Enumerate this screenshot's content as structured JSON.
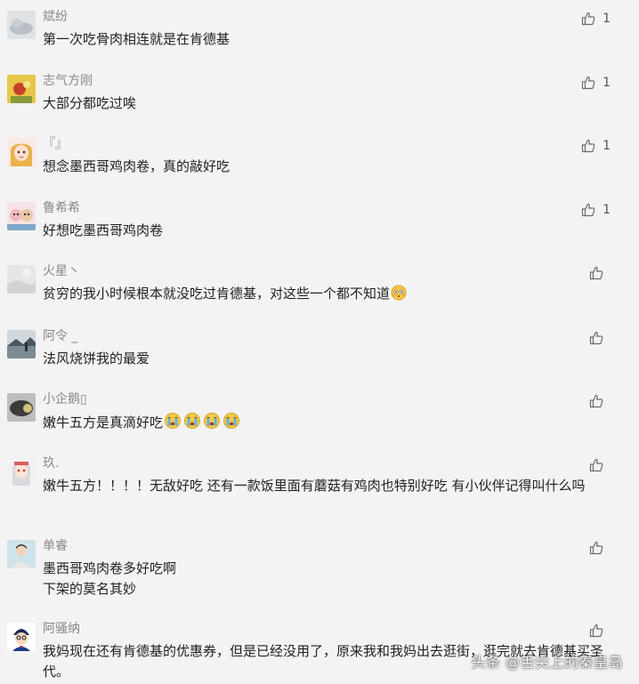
{
  "comments": [
    {
      "user": "斌纷",
      "text": "第一次吃骨肉相连就是在肯德基",
      "likes": "1",
      "avatar_icon": "gray-cloud-avatar-icon"
    },
    {
      "user": "志气方刚",
      "text": "大部分都吃过唉",
      "likes": "1",
      "avatar_icon": "yellow-flower-avatar-icon"
    },
    {
      "user": "『』",
      "text": "想念墨西哥鸡肉卷，真的敲好吃",
      "likes": "1",
      "avatar_icon": "cartoon-girl-avatar-icon"
    },
    {
      "user": "鲁希希",
      "text": "好想吃墨西哥鸡肉卷",
      "likes": "1",
      "avatar_icon": "pink-cartoon-avatar-icon"
    },
    {
      "user": "火星丶",
      "text": "贫穷的我小时候根本就没吃过肯德基，对这些一个都不知道",
      "likes": "",
      "avatar_icon": "gray-blur-avatar-icon"
    },
    {
      "user": "阿令 _",
      "text": "法风烧饼我的最爱",
      "likes": "",
      "avatar_icon": "landscape-avatar-icon"
    },
    {
      "user": "小企鹅▯",
      "text": "嫩牛五方是真滴好吃",
      "likes": "",
      "avatar_icon": "dark-object-avatar-icon"
    },
    {
      "user": "玖.",
      "text": "嫩牛五方！！！！无敌好吃 还有一款饭里面有蘑菇有鸡肉也特别好吃 有小伙伴记得叫什么吗",
      "likes": "",
      "avatar_icon": "anime-avatar-icon"
    },
    {
      "user": "单睿",
      "text": "墨西哥鸡肉卷多好吃啊",
      "text2": "下架的莫名其妙",
      "likes": "",
      "avatar_icon": "person-avatar-icon"
    },
    {
      "user": "阿骚纳",
      "text": "我妈现在还有肯德基的优惠券，但是已经没用了，原来我和我妈出去逛街，逛完就去肯德基买圣代。",
      "likes": "",
      "avatar_icon": "detective-avatar-icon"
    }
  ],
  "watermark": "头条 @舌尖上的秦皇岛",
  "colors": {
    "background": "#f3f3f3",
    "username": "#888888",
    "text": "#222222",
    "icon": "#6b6b6b"
  }
}
